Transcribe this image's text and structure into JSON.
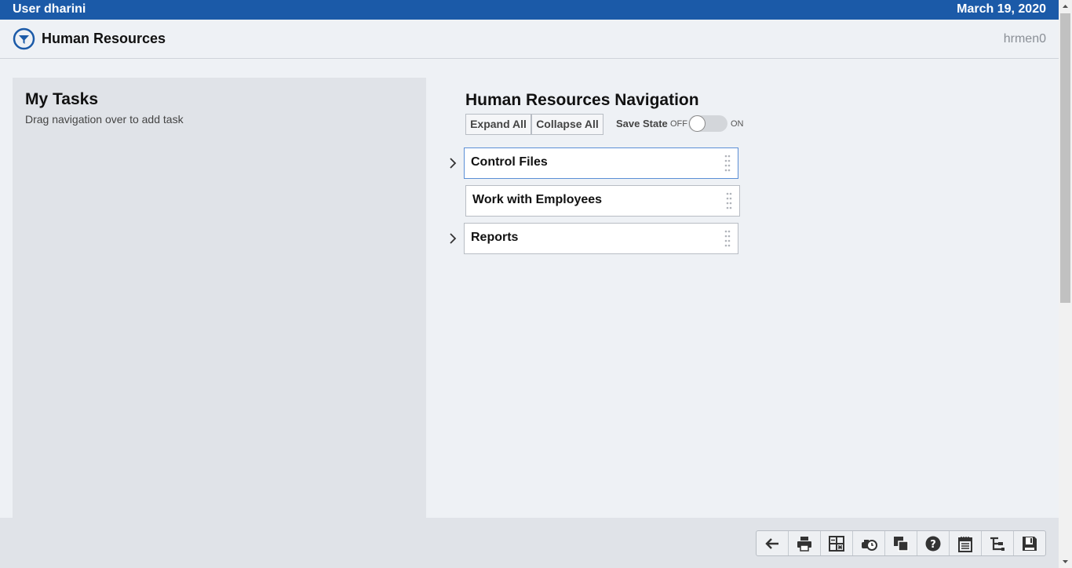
{
  "topbar": {
    "user": "User dharini",
    "date": "March 19, 2020"
  },
  "header": {
    "title": "Human Resources",
    "code": "hrmen0",
    "logo_icon": "funnel-circle-icon"
  },
  "tasks": {
    "title": "My Tasks",
    "subtitle": "Drag navigation over to add task"
  },
  "nav": {
    "title": "Human Resources Navigation",
    "expand_all": "Expand All",
    "collapse_all": "Collapse All",
    "save_state_label": "Save State",
    "toggle_off": "OFF",
    "toggle_on": "ON",
    "toggle_state": "off",
    "items": [
      {
        "label": "Control Files",
        "expandable": true
      },
      {
        "label": "Work with Employees",
        "expandable": false
      },
      {
        "label": "Reports",
        "expandable": true
      }
    ]
  },
  "toolbar": {
    "buttons": [
      "back-arrow-icon",
      "print-icon",
      "spreadsheet-icon",
      "schedule-icon",
      "windows-icon",
      "help-icon",
      "notepad-icon",
      "tree-icon",
      "save-icon"
    ]
  },
  "colors": {
    "brand": "#1b5aa8",
    "background": "#eef1f5",
    "panel": "#e0e3e8"
  }
}
